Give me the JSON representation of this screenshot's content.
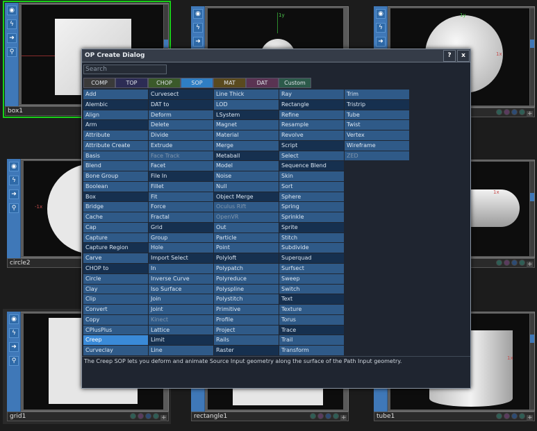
{
  "nodes": {
    "box1": {
      "name": "box1"
    },
    "circle2": {
      "name": "circle2"
    },
    "grid1": {
      "name": "grid1"
    },
    "rectangle1": {
      "name": "rectangle1"
    },
    "tube1": {
      "name": "tube1"
    }
  },
  "axis_labels": {
    "y": "1y",
    "x": "1x",
    "neg_x": "-1x"
  },
  "dialog": {
    "title": "OP Create Dialog",
    "help_label": "?",
    "close_label": "x",
    "search_placeholder": "Search",
    "tabs": [
      {
        "label": "COMP",
        "color": "#3a3a3a"
      },
      {
        "label": "TOP",
        "color": "#2c2c54"
      },
      {
        "label": "CHOP",
        "color": "#3b5a2a"
      },
      {
        "label": "SOP",
        "color": "#2f7ec4"
      },
      {
        "label": "MAT",
        "color": "#5a4a1e"
      },
      {
        "label": "DAT",
        "color": "#5a3352"
      },
      {
        "label": "Custom",
        "color": "#2c5a4a"
      }
    ],
    "active_tab": "SOP",
    "columns": [
      [
        "Add",
        "Alembic",
        "Align",
        "Arm",
        "Attribute",
        "Attribute Create",
        "Basis",
        "Blend",
        "Bone Group",
        "Boolean",
        "Box",
        "Bridge",
        "Cache",
        "Cap",
        "Capture",
        "Capture Region",
        "Carve",
        "CHOP to",
        "Circle",
        "Clay",
        "Clip",
        "Convert",
        "Copy",
        "CPlusPlus",
        "Creep",
        "Curveclay"
      ],
      [
        "Curvesect",
        "DAT to",
        "Deform",
        "Delete",
        "Divide",
        "Extrude",
        "Face Track",
        "Facet",
        "File In",
        "Fillet",
        "Fit",
        "Force",
        "Fractal",
        "Grid",
        "Group",
        "Hole",
        "Import Select",
        "In",
        "Inverse Curve",
        "Iso Surface",
        "Join",
        "Joint",
        "Kinect",
        "Lattice",
        "Limit",
        "Line"
      ],
      [
        "Line Thick",
        "LOD",
        "LSystem",
        "Magnet",
        "Material",
        "Merge",
        "Metaball",
        "Model",
        "Noise",
        "Null",
        "Object Merge",
        "Oculus Rift",
        "OpenVR",
        "Out",
        "Particle",
        "Point",
        "Polyloft",
        "Polypatch",
        "Polyreduce",
        "Polyspline",
        "Polystitch",
        "Primitive",
        "Profile",
        "Project",
        "Rails",
        "Raster"
      ],
      [
        "Ray",
        "Rectangle",
        "Refine",
        "Resample",
        "Revolve",
        "Script",
        "Select",
        "Sequence Blend",
        "Skin",
        "Sort",
        "Sphere",
        "Spring",
        "Sprinkle",
        "Sprite",
        "Stitch",
        "Subdivide",
        "Superquad",
        "Surfsect",
        "Sweep",
        "Switch",
        "Text",
        "Texture",
        "Torus",
        "Trace",
        "Trail",
        "Transform"
      ],
      [
        "Trim",
        "Tristrip",
        "Tube",
        "Twist",
        "Vertex",
        "Wireframe",
        "ZED"
      ]
    ],
    "dark_cells": [
      "Alembic",
      "Arm",
      "Box",
      "Capture Region",
      "CHOP to",
      "Curvesect",
      "DAT to",
      "File In",
      "Grid",
      "Import Select",
      "Limit",
      "LSystem",
      "Metaball",
      "Object Merge",
      "Polyloft",
      "Raster",
      "Rectangle",
      "Script",
      "Sequence Blend",
      "Sprite",
      "Superquad",
      "Text",
      "Trace",
      "Tristrip"
    ],
    "disabled_cells": [
      "Face Track",
      "Kinect",
      "Oculus Rift",
      "OpenVR",
      "ZED"
    ],
    "selected_cell": "Creep",
    "status_text": "The Creep SOP lets you deform and animate Source Input geometry along the surface of the Path Input geometry."
  }
}
